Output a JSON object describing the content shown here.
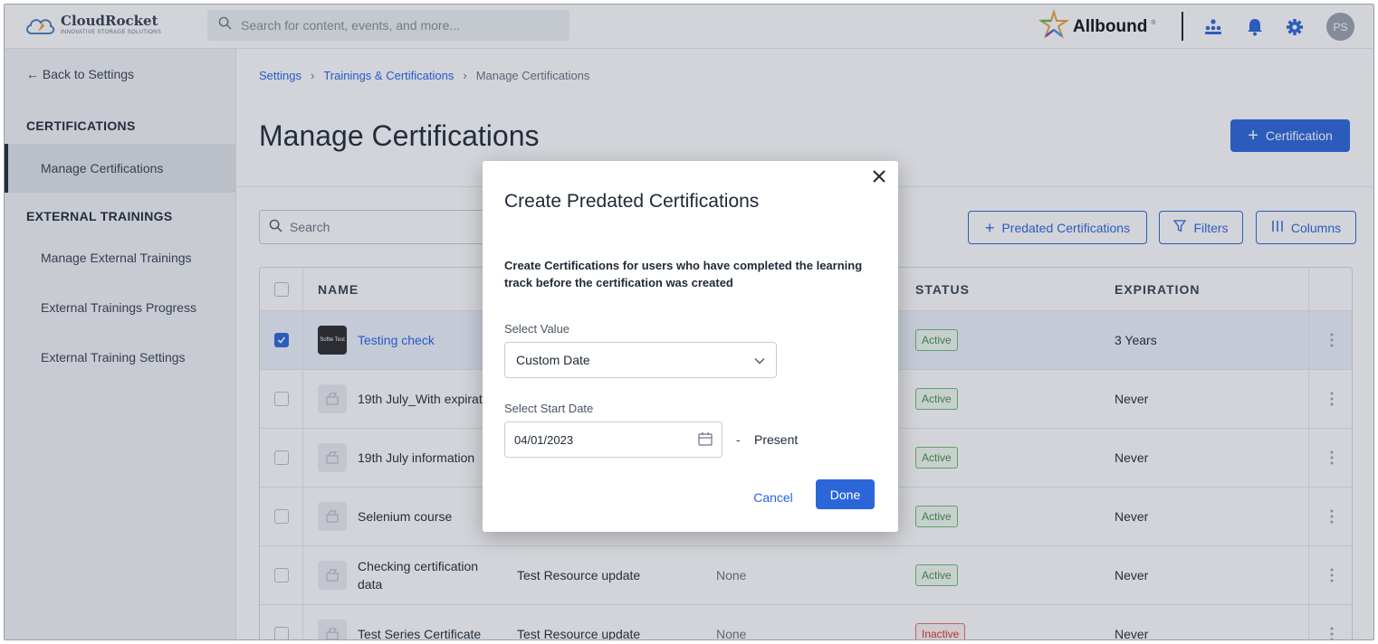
{
  "app": {
    "logo_name": "CloudRocket",
    "logo_tagline": "INNOVATIVE STORAGE SOLUTIONS",
    "brand": "Allbound",
    "search_placeholder": "Search for content, events, and more...",
    "avatar_initials": "PS"
  },
  "sidebar": {
    "back_label": "← Back to Settings",
    "sections": [
      {
        "heading": "CERTIFICATIONS",
        "items": [
          {
            "label": "Manage Certifications",
            "active": true
          }
        ]
      },
      {
        "heading": "EXTERNAL TRAININGS",
        "items": [
          {
            "label": "Manage External Trainings"
          },
          {
            "label": "External Trainings Progress"
          },
          {
            "label": "External Training Settings"
          }
        ]
      }
    ]
  },
  "main": {
    "breadcrumb": [
      "Settings",
      "Trainings & Certifications",
      "Manage Certifications"
    ],
    "title": "Manage Certifications",
    "add_button": "Certification",
    "table_search_placeholder": "Search",
    "predated_button": "Predated Certifications",
    "filters_button": "Filters",
    "columns_button": "Columns",
    "columns": {
      "name": "NAME",
      "status": "STATUS",
      "expiration": "EXPIRATION"
    },
    "rows": [
      {
        "name": "Testing check",
        "thumb": "Softw Test",
        "col2": "",
        "col3": "",
        "status": "Active",
        "expiration": "3 Years",
        "selected": true
      },
      {
        "name": "19th July_With expirat",
        "col2": "",
        "col3": "",
        "status": "Active",
        "expiration": "Never"
      },
      {
        "name": "19th July information",
        "col2": "",
        "col3": "",
        "status": "Active",
        "expiration": "Never"
      },
      {
        "name": "Selenium course",
        "col2": "",
        "col3": "",
        "status": "Active",
        "expiration": "Never"
      },
      {
        "name": "Checking certification",
        "name2": "data",
        "col2": "Test Resource update",
        "col3": "None",
        "status": "Active",
        "expiration": "Never"
      },
      {
        "name": "Test Series Certificate",
        "col2": "Test Resource update",
        "col3": "None",
        "status": "Inactive",
        "expiration": "Never"
      }
    ]
  },
  "modal": {
    "title": "Create Predated Certifications",
    "description": "Create Certifications for users who have completed the learning track before the certification was created",
    "select_label": "Select Value",
    "select_value": "Custom Date",
    "date_label": "Select Start Date",
    "date_value": "04/01/2023",
    "dash": "-",
    "present": "Present",
    "cancel": "Cancel",
    "done": "Done"
  },
  "colors": {
    "primary": "#2b66d9",
    "link": "#2563eb",
    "active": "#3f9142",
    "inactive": "#d0342c"
  }
}
